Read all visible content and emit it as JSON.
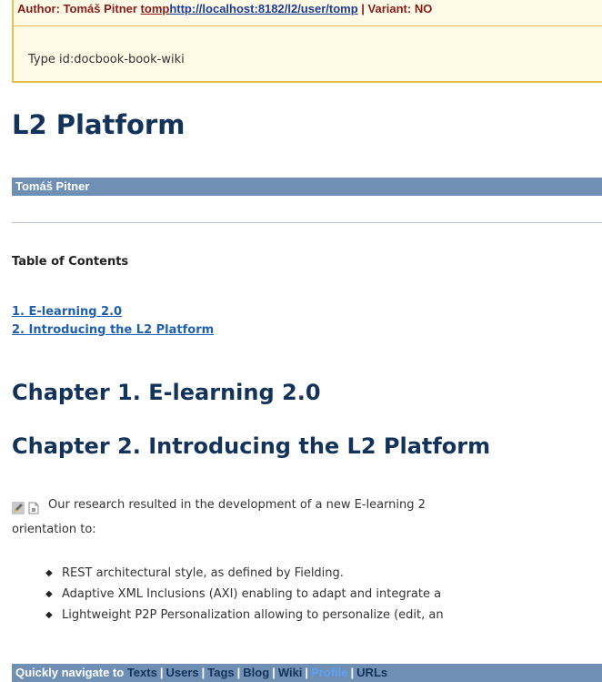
{
  "info": {
    "prefix": "Author: Tomáš Pitner ",
    "author_link": "tomp",
    "url_link": "http://localhost:8182/l2/user/tomp",
    "suffix": " | Variant: NO",
    "type_id": "Type id:docbook-book-wiki"
  },
  "doc": {
    "title": "L2 Platform",
    "author": "Tomáš Pitner",
    "toc_title": "Table of Contents",
    "toc": [
      "1. E-learning 2.0",
      "2. Introducing the L2 Platform"
    ],
    "chapter1": "Chapter 1. E-learning 2.0",
    "chapter2": "Chapter 2. Introducing the L2 Platform",
    "para_line1": "Our research resulted in the development of a new E-learning 2",
    "para_line2": "orientation to:",
    "bullets": [
      "REST architectural style, as defined by Fielding.",
      "Adaptive XML Inclusions (AXI) enabling to adapt and integrate a",
      "Lightweight P2P Personalization allowing to personalize (edit, an"
    ]
  },
  "nav": {
    "label": "Quickly navigate to",
    "items": [
      "Texts",
      "Users",
      "Tags",
      "Blog",
      "Wiki",
      "Profile",
      "URLs"
    ],
    "active": "Profile"
  },
  "colors": {
    "title": "#13335a",
    "bar": "#6f8fb5",
    "link": "#1f5fb0",
    "info_border": "#e6c04a"
  },
  "icons": [
    "edit-icon",
    "document-icon"
  ]
}
